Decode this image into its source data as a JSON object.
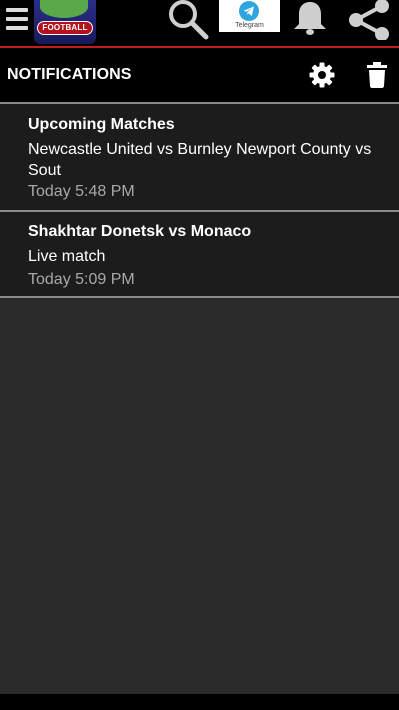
{
  "app": {
    "logo_text": "FOOTBALL",
    "telegram_label": "Telegram",
    "icons": {
      "menu": "menu-icon",
      "search": "search-icon",
      "telegram": "telegram-icon",
      "bell": "bell-icon",
      "share": "share-icon",
      "settings": "gear-icon",
      "delete": "trash-icon"
    },
    "accent_color": "#c21d1d"
  },
  "header": {
    "title": "NOTIFICATIONS"
  },
  "notifications": [
    {
      "title": "Upcoming Matches",
      "body": "Newcastle United vs Burnley Newport County vs Sout",
      "time": "Today 5:48 PM"
    },
    {
      "title": "Shakhtar Donetsk  vs  Monaco",
      "body": "Live match",
      "time": "Today 5:09 PM"
    }
  ]
}
